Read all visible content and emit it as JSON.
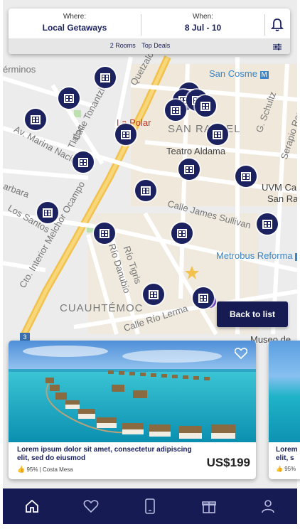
{
  "search": {
    "where_caption": "Where:",
    "where_value": "Local Getaways",
    "when_caption": "When:",
    "when_value": "8 Jul - 10",
    "rooms": "2 Rooms",
    "deals": "Top Deals"
  },
  "map": {
    "labels": {
      "erminos": "érminos",
      "quetzalco": "Quetzalco",
      "san_cosme": "San Cosme",
      "calle_tonantzin": "Calle Tonantzin",
      "la_polar": "La Polar",
      "san_rafael": "SAN RAFAEL",
      "schultz": "G. Schultz",
      "serapio": "Serapio Rendo",
      "av_marina": "Av. Marina Nacional",
      "tlaloc": "Tlaloc",
      "teatro": "Teatro Aldama",
      "ocampo": "Calle Interior Melchor Ocampo",
      "uvm1": "UVM Ca",
      "uvm2": "San Ra",
      "sarbara": "arbara",
      "los_santos": "Los Santos",
      "james_sullivan": "Calle James Sullivan",
      "rio_danubio": "Río Danubio",
      "rio_tigris": "Río Tigris",
      "metrobus": "Metrobus Reforma",
      "cto_interior": "Cto. Interior Melchor Ocampo",
      "cuauhtemoc": "CUAUHTÉMOC",
      "calle_rio_lerma": "Calle Río Lerma",
      "museo": "Museo de",
      "gro": "ro"
    },
    "hotel_marker_icon": "hotel-icon",
    "hotel_count": 20
  },
  "back_button": "Back to list",
  "cards": [
    {
      "title": "Lorem ipsum dolor sit amet, consectetur adipiscing elit, sed do eiusmod",
      "rating": "95% | Costa Mesa",
      "price": "US$199"
    },
    {
      "title_line1": "Lorem",
      "title_line2": "elit, s",
      "rating": "95%"
    }
  ],
  "tabs": [
    "home-icon",
    "heart-icon",
    "phone-icon",
    "gift-icon",
    "user-icon"
  ],
  "colors": {
    "navy": "#161b54",
    "accent": "#1c2260",
    "sea": "#1fb3c8"
  }
}
